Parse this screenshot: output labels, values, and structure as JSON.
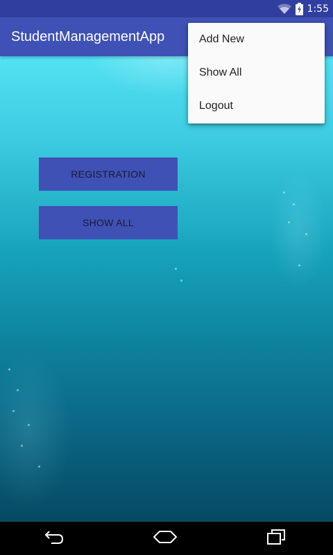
{
  "status_bar": {
    "time": "1:55",
    "icons": [
      "wifi-icon",
      "battery-icon"
    ]
  },
  "app_bar": {
    "title": "StudentManagementApp",
    "color": "#3F51B5"
  },
  "main": {
    "buttons": [
      {
        "label": "REGISTRATION"
      },
      {
        "label": "SHOW ALL"
      }
    ]
  },
  "overflow_menu": {
    "items": [
      {
        "label": "Add New"
      },
      {
        "label": "Show All"
      },
      {
        "label": "Logout"
      }
    ]
  },
  "nav_bar": {
    "icons": [
      "back-icon",
      "home-icon",
      "recents-icon"
    ]
  },
  "colors": {
    "primary": "#3F51B5",
    "primary_dark": "#303F9F"
  }
}
